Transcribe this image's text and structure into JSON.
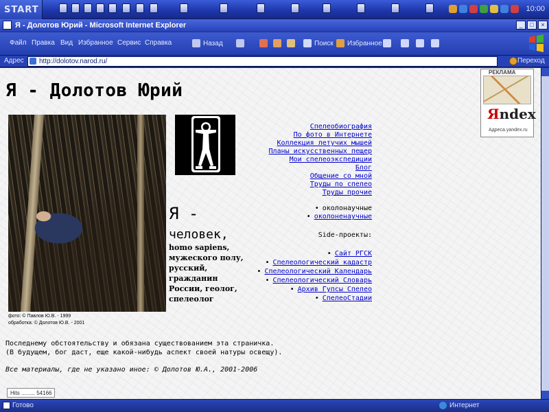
{
  "taskbar": {
    "start_label": "START",
    "clock": "10:00",
    "tray_colors": [
      "#e0a030",
      "#4080e0",
      "#d04040",
      "#40a040",
      "#e0c040"
    ]
  },
  "window": {
    "title": "Я - Долотов Юрий - Microsoft Internet Explorer",
    "minimize_icon": "minimize-icon",
    "maximize_icon": "maximize-icon",
    "close_icon": "close-icon"
  },
  "menu": {
    "items": [
      "Файл",
      "Правка",
      "Вид",
      "Избранное",
      "Сервис",
      "Справка"
    ]
  },
  "toolbar": {
    "back_label": "Назад",
    "search_label": "Поиск",
    "favorites_label": "Избранное"
  },
  "address": {
    "label": "Адрес",
    "url": "http://dolotov.narod.ru/",
    "go_label": "Переход"
  },
  "page": {
    "title": "Я - Долотов Юрий",
    "photo_credit_line1": "фото: © Павлов Ю.В. - 1999",
    "photo_credit_line2": "обработка: © Долотов Ю.В. - 2001",
    "side_big": "Я -",
    "side_human": "человек,",
    "side_text": "homo sapiens, мужеского полу, русский, гражданин России, геолог, спелеолог",
    "nav_links": [
      "Спелеобиография",
      "По фото в Интернете",
      "Коллекция летучих мышей",
      "Планы искусственных пещер",
      "Мои спелеоэкспедиции",
      "Блог",
      "Общение со мной",
      "Труды по спелео",
      "Труды прочие"
    ],
    "bullet_links": [
      "околонаучные",
      "околоненаучные"
    ],
    "side_projects_label": "Side-проекты:",
    "side_projects": [
      "Сайт РГСК",
      "Спелеологический кадастр",
      "Спелеологический Календарь",
      "Спелеологический Словарь",
      "Архив Гупсы Спелео",
      "СпелеоСтадии"
    ],
    "footer_line1": "Последнему обстоятельству и обязана существованием эта страничка.",
    "footer_line2": "(В будущем, бог даст, еще какой-нибудь аспект своей натуры освещу).",
    "copyright": "Все материалы, где не указано иное: © Долотов Ю.А., 2001-2006",
    "counter": "Hits ......... 54166"
  },
  "ad": {
    "label": "РЕКЛАМА",
    "brand_y": "Я",
    "brand_rest": "ndex",
    "url": "Адреса.yandex.ru"
  },
  "status": {
    "text": "Готово",
    "zone": "Интернет"
  }
}
